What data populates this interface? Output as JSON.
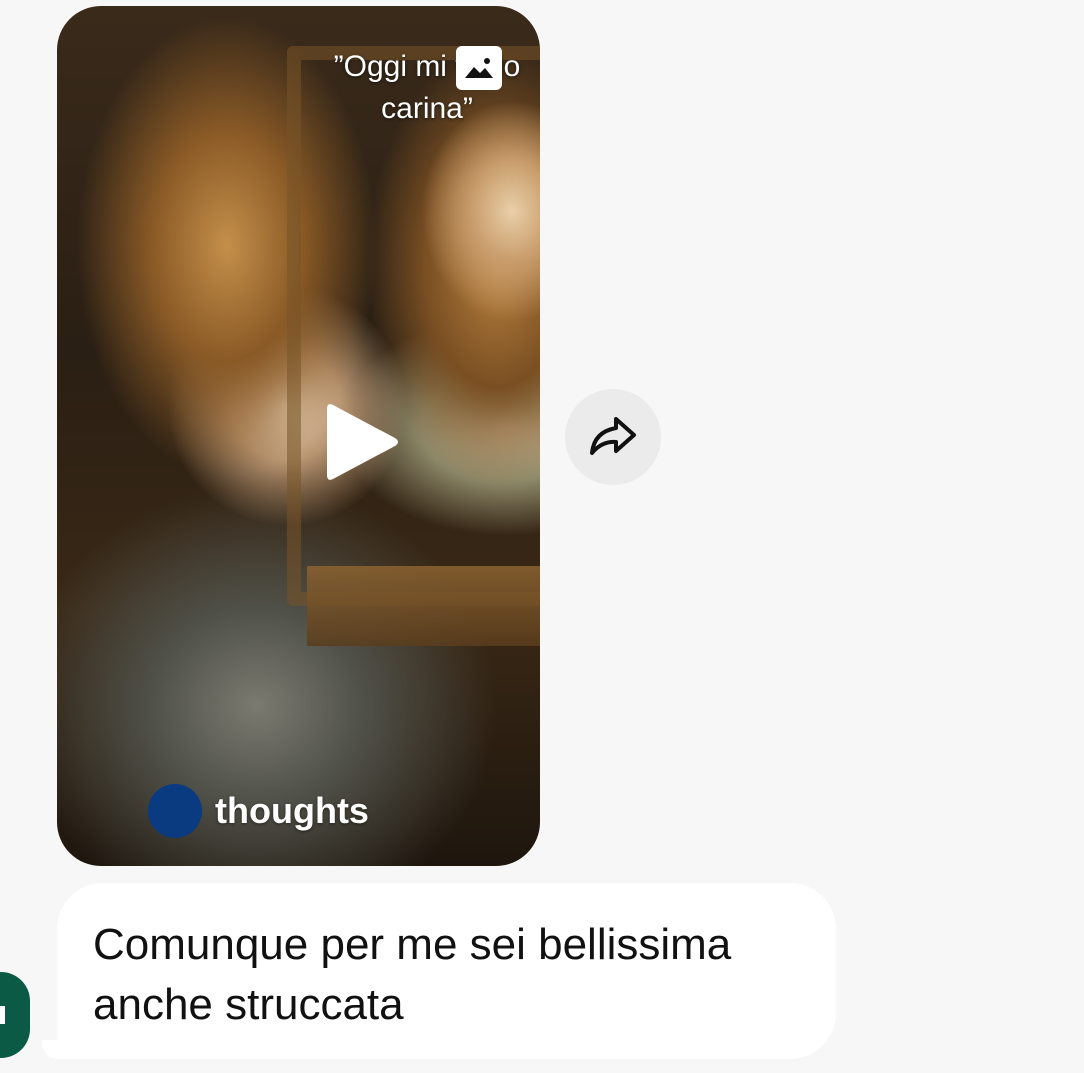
{
  "reel": {
    "caption_line1": "”Oggi mi vedo",
    "caption_line2": "carina”",
    "author_name": "thoughts",
    "play_icon": "play-icon",
    "caption_badge_icon": "image-icon"
  },
  "share": {
    "icon": "share-arrow-icon"
  },
  "message": {
    "line1": "Comunque per me sei bellissima",
    "line2": "anche struccata"
  },
  "colors": {
    "background": "#f7f7f7",
    "bubble": "#ffffff",
    "author_avatar": "#0a3a80",
    "sender_avatar": "#0b5a46",
    "share_button": "#ebebeb"
  }
}
